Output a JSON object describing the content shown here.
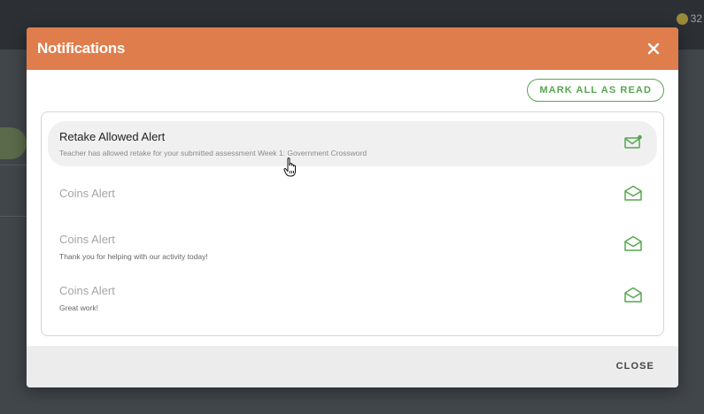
{
  "background": {
    "coin_count": "32"
  },
  "modal": {
    "title": "Notifications",
    "mark_all_label": "MARK ALL AS READ",
    "close_label": "CLOSE",
    "accent_color": "#df7d4c",
    "green_color": "#57a64f"
  },
  "notifications": [
    {
      "title": "Retake Allowed Alert",
      "message": "Teacher has allowed retake for your submitted assessment Week 1: Government Crossword",
      "status": "unread",
      "icon": "envelope-closed-unread-icon"
    },
    {
      "title": "Coins Alert",
      "message": "",
      "status": "read",
      "icon": "envelope-open-icon"
    },
    {
      "title": "Coins Alert",
      "message": "Thank you for helping with our activity today!",
      "status": "read",
      "icon": "envelope-open-icon"
    },
    {
      "title": "Coins Alert",
      "message": "Great work!",
      "status": "read",
      "icon": "envelope-open-icon"
    }
  ]
}
